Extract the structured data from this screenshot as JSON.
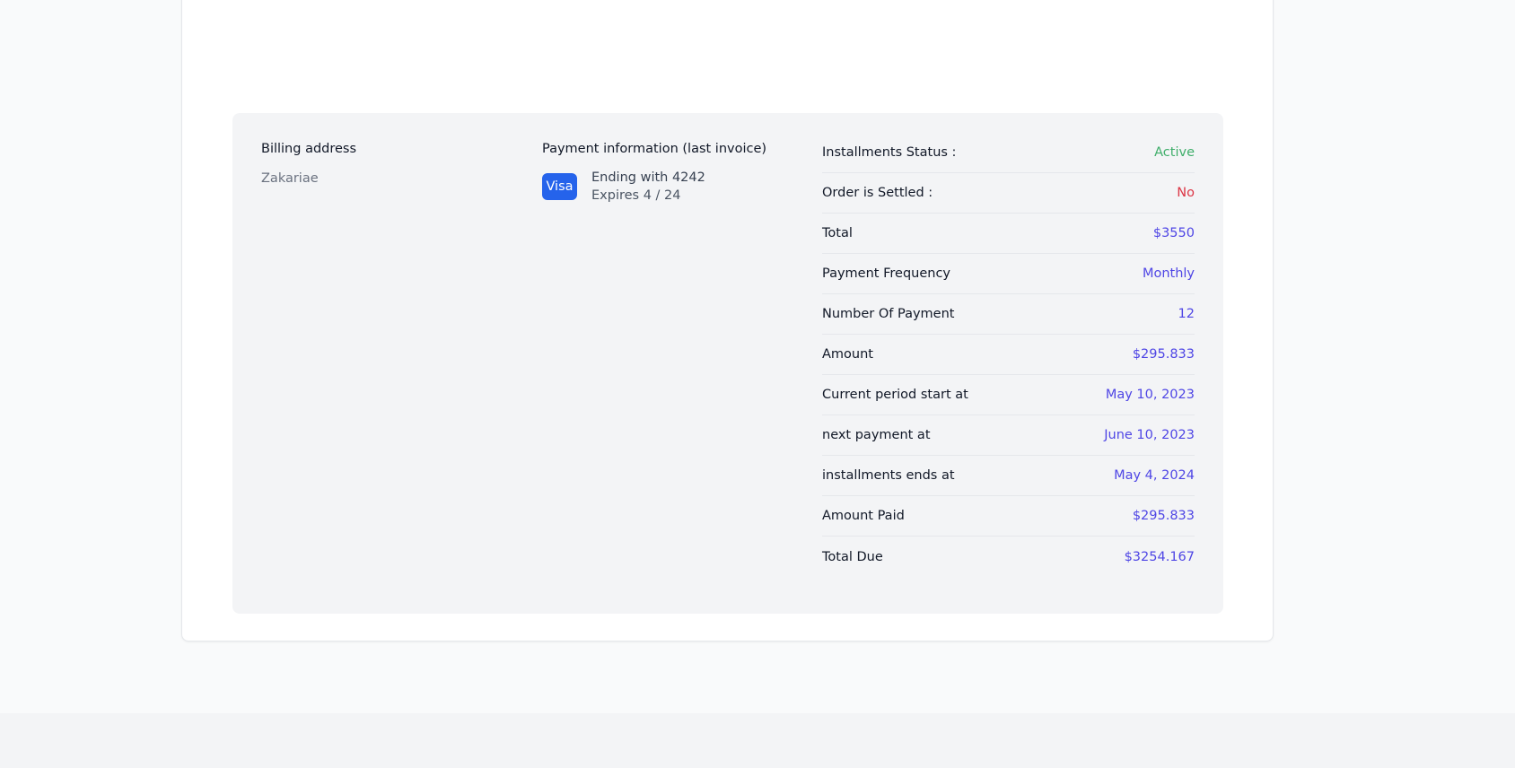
{
  "billing": {
    "title": "Billing address",
    "name": "Zakariae"
  },
  "payment": {
    "title": "Payment information (last invoice)",
    "brand": "Visa",
    "ending": "Ending with 4242",
    "expires": "Expires 4 / 24"
  },
  "colors": {
    "active": "#3fae6a",
    "negative": "#dc3545",
    "value": "#4f46e5",
    "visa": "#2563eb"
  },
  "details": [
    {
      "label": "Installments Status :",
      "value": "Active",
      "color": "#3fae6a"
    },
    {
      "label": "Order is Settled :",
      "value": "No",
      "color": "#dc3545"
    },
    {
      "label": "Total",
      "value": "$3550",
      "color": "#4f46e5"
    },
    {
      "label": "Payment Frequency",
      "value": "Monthly",
      "color": "#4f46e5"
    },
    {
      "label": "Number Of Payment",
      "value": "12",
      "color": "#4f46e5"
    },
    {
      "label": "Amount",
      "value": "$295.833",
      "color": "#4f46e5"
    },
    {
      "label": "Current period start at",
      "value": "May 10, 2023",
      "color": "#4f46e5"
    },
    {
      "label": "next payment at",
      "value": "June 10, 2023",
      "color": "#4f46e5"
    },
    {
      "label": "installments ends at",
      "value": "May 4, 2024",
      "color": "#4f46e5"
    },
    {
      "label": "Amount Paid",
      "value": "$295.833",
      "color": "#4f46e5"
    },
    {
      "label": "Total Due",
      "value": "$3254.167",
      "color": "#4f46e5"
    }
  ]
}
